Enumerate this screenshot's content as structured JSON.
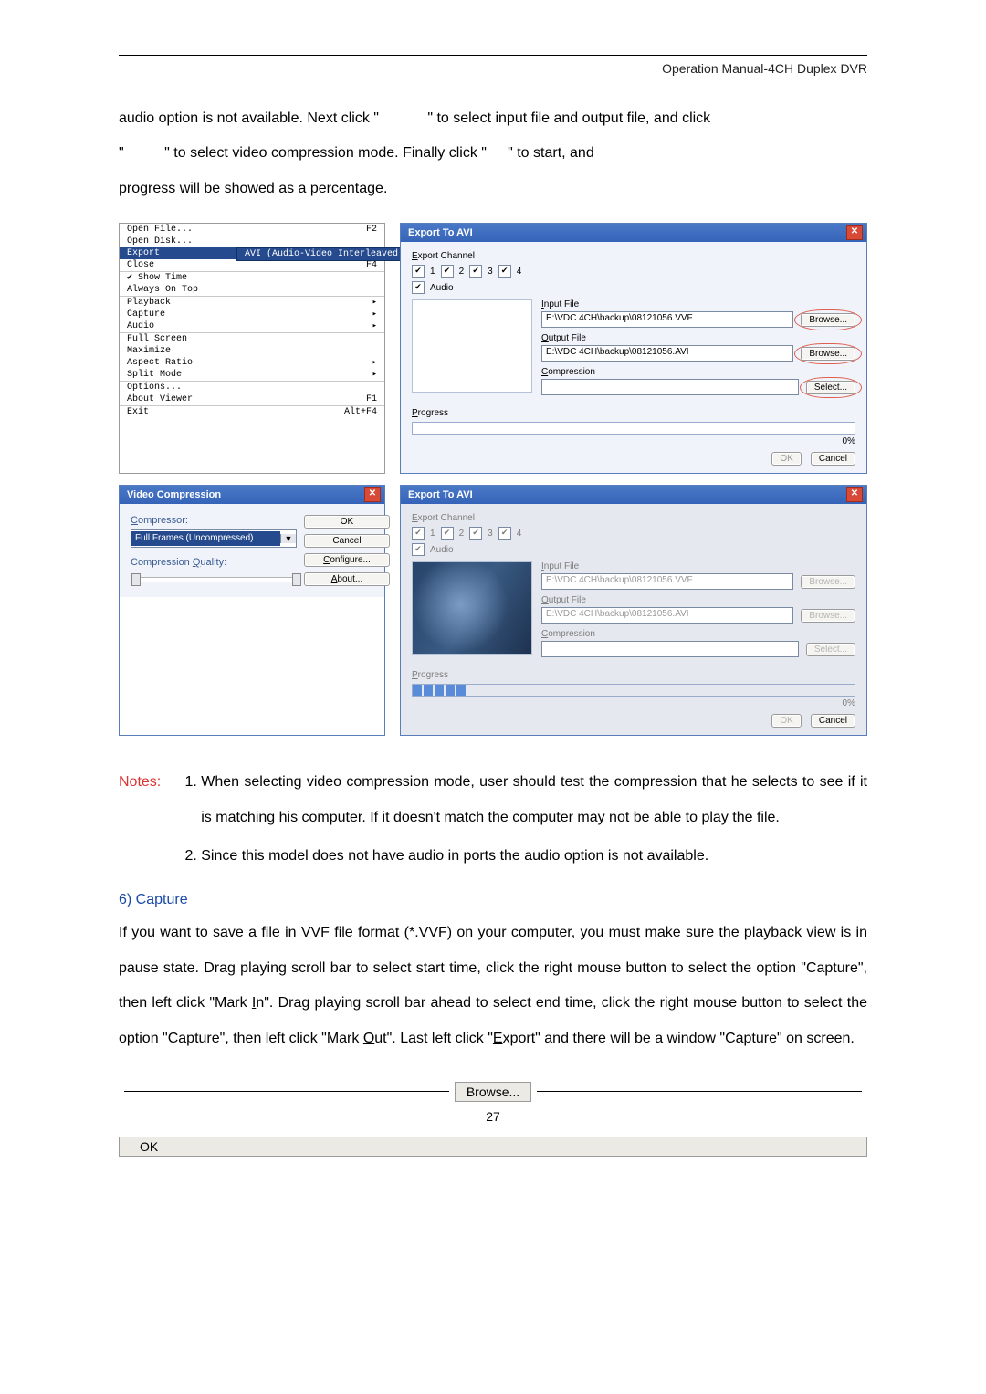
{
  "header": {
    "title": "Operation Manual-4CH Duplex DVR"
  },
  "intro": {
    "line1_a": "audio option is not available. Next click \"",
    "line1_b": "\" to select input file and output file, and click",
    "line2_a": "\"",
    "line2_b": "\"  to  select  video  compression  mode.  Finally  click  \"",
    "line2_c": "\"  to  start,  and",
    "line3": "progress will be showed as a percentage."
  },
  "context_menu": {
    "open_file": {
      "label": "Open File...",
      "accel": "F2"
    },
    "open_disk": {
      "label": "Open Disk..."
    },
    "export": {
      "label": "Export",
      "sub_label": "AVI (Audio-Video Interleaved Files)"
    },
    "close": {
      "label": "Close",
      "accel": "F4"
    },
    "show_time": {
      "label": "Show Time",
      "checked": true
    },
    "always_on_top": {
      "label": "Always On Top"
    },
    "playback": {
      "label": "Playback"
    },
    "capture": {
      "label": "Capture"
    },
    "audio": {
      "label": "Audio"
    },
    "full_screen": {
      "label": "Full Screen"
    },
    "maximize": {
      "label": "Maximize"
    },
    "aspect_ratio": {
      "label": "Aspect Ratio"
    },
    "split_mode": {
      "label": "Split Mode"
    },
    "options": {
      "label": "Options..."
    },
    "about": {
      "label": "About Viewer",
      "accel": "F1"
    },
    "exit": {
      "label": "Exit",
      "accel": "Alt+F4"
    }
  },
  "export_dialog": {
    "title": "Export To AVI",
    "export_channel_label": "Export Channel",
    "channels": [
      "1",
      "2",
      "3",
      "4"
    ],
    "audio_label": "Audio",
    "input_label": "Input File",
    "input_value": "E:\\VDC 4CH\\backup\\08121056.VVF",
    "output_label": "Output File",
    "output_value": "E:\\VDC 4CH\\backup\\08121056.AVI",
    "compression_label": "Compression",
    "browse_btn": "Browse...",
    "select_btn": "Select...",
    "progress_label": "Progress",
    "progress_pct": "0%",
    "ok_btn": "OK",
    "cancel_btn": "Cancel"
  },
  "vc_dialog": {
    "title": "Video Compression",
    "compressor_label": "Compressor:",
    "compressor_value": "Full Frames (Uncompressed)",
    "quality_label": "Compression Quality:",
    "ok": "OK",
    "cancel": "Cancel",
    "configure": "Configure...",
    "about": "About..."
  },
  "notes": {
    "label": "Notes:",
    "item1": "When selecting video compression mode, user should test the compression that he selects to see if it is matching his computer. If it doesn't match the computer may not be able to play the file.",
    "item2": "Since this model does not have audio in ports the audio option is not available."
  },
  "section6": {
    "heading": "6) Capture",
    "para_a": "If you want to save a file in VVF file format (*.VVF) on your computer, you must make sure the playback view is in pause state. Drag playing scroll bar to select start time, click the right mouse button to select the option \"Capture\", then left click \"Mark ",
    "in_u": "I",
    "in_rest": "n",
    "para_b": "\". Drag playing scroll bar ahead to select end time, click the right mouse button to select the option \"Capture\", then left click \"Mark ",
    "out_u": "O",
    "out_rest": "ut",
    "para_c": "\".   Last left click \"",
    "exp_u": "E",
    "exp_rest": "xport",
    "para_d": "\" and there will be a window \"Capture\" on screen."
  },
  "bottom": {
    "browse": "Browse...",
    "ok": "OK",
    "page": "27"
  }
}
